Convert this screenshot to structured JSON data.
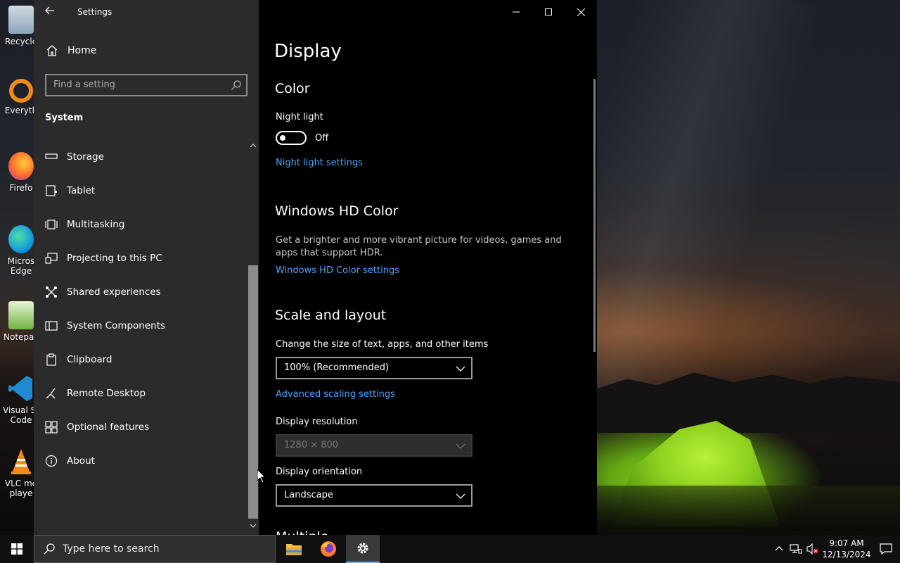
{
  "desktop": {
    "icons": [
      {
        "label": "Recycle",
        "color": "#9fb8d0"
      },
      {
        "label": "Everyth",
        "color": "#f08a1c"
      },
      {
        "label": "Firefo",
        "color": "#ff7b2a"
      },
      {
        "label": "Micros Edge",
        "color": "#1aa3d9"
      },
      {
        "label": "Notepac",
        "color": "#6db33f"
      },
      {
        "label": "Visual St Code",
        "color": "#1f8ad2"
      },
      {
        "label": "VLC me playe",
        "color": "#f08a1c"
      }
    ]
  },
  "window": {
    "app_title": "Settings",
    "sidebar": {
      "home_label": "Home",
      "search_placeholder": "Find a setting",
      "section_label": "System",
      "items": [
        {
          "label": "Storage",
          "icon": "storage-icon"
        },
        {
          "label": "Tablet",
          "icon": "tablet-icon"
        },
        {
          "label": "Multitasking",
          "icon": "multitasking-icon"
        },
        {
          "label": "Projecting to this PC",
          "icon": "projecting-icon"
        },
        {
          "label": "Shared experiences",
          "icon": "shared-experiences-icon"
        },
        {
          "label": "System Components",
          "icon": "system-components-icon"
        },
        {
          "label": "Clipboard",
          "icon": "clipboard-icon"
        },
        {
          "label": "Remote Desktop",
          "icon": "remote-desktop-icon"
        },
        {
          "label": "Optional features",
          "icon": "optional-features-icon"
        },
        {
          "label": "About",
          "icon": "about-icon"
        }
      ]
    },
    "content": {
      "page_title": "Display",
      "color_heading": "Color",
      "night_light_label": "Night light",
      "night_light_state": "Off",
      "night_light_settings_link": "Night light settings",
      "hd_color_heading": "Windows HD Color",
      "hd_color_desc": "Get a brighter and more vibrant picture for videos, games and apps that support HDR.",
      "hd_color_settings_link": "Windows HD Color settings",
      "scale_heading": "Scale and layout",
      "scale_label": "Change the size of text, apps, and other items",
      "scale_value": "100% (Recommended)",
      "advanced_scaling_link": "Advanced scaling settings",
      "resolution_label": "Display resolution",
      "resolution_value": "1280 × 800",
      "orientation_label": "Display orientation",
      "orientation_value": "Landscape",
      "next_heading_partial": "Multiple displays"
    }
  },
  "taskbar": {
    "search_placeholder": "Type here to search",
    "apps": [
      {
        "name": "file-explorer",
        "active": false
      },
      {
        "name": "firefox",
        "active": false
      },
      {
        "name": "settings",
        "active": true
      }
    ],
    "clock_time": "9:07 AM",
    "clock_date": "12/13/2024"
  },
  "colors": {
    "accent_link": "#4ca3ff",
    "sidebar_bg": "#2b2b2b",
    "content_bg": "#000000",
    "taskbar_bg": "#101010"
  }
}
